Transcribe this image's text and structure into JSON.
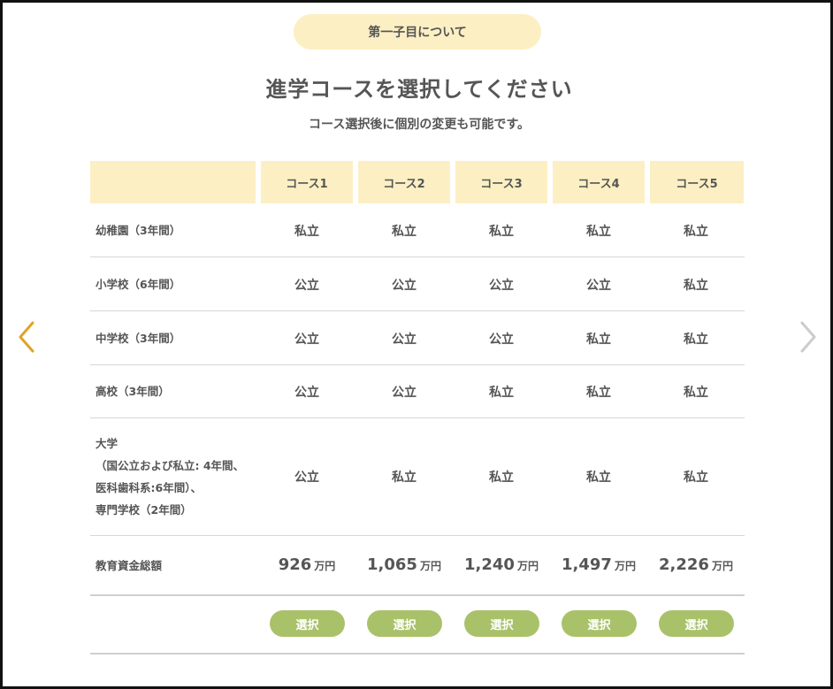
{
  "header": {
    "pill_label": "第一子目について",
    "title": "進学コースを選択してください",
    "subtitle": "コース選択後に個別の変更も可能です。"
  },
  "table": {
    "columns": [
      "コース1",
      "コース2",
      "コース3",
      "コース4",
      "コース5"
    ],
    "rows": [
      {
        "label": "幼稚園（3年間）",
        "values": [
          "私立",
          "私立",
          "私立",
          "私立",
          "私立"
        ]
      },
      {
        "label": "小学校（6年間）",
        "values": [
          "公立",
          "公立",
          "公立",
          "公立",
          "私立"
        ]
      },
      {
        "label": "中学校（3年間）",
        "values": [
          "公立",
          "公立",
          "公立",
          "私立",
          "私立"
        ]
      },
      {
        "label": "高校（3年間）",
        "values": [
          "公立",
          "公立",
          "私立",
          "私立",
          "私立"
        ]
      },
      {
        "label_lines": [
          "大学",
          "（国公立および私立: 4年間、",
          "医科歯科系:6年間）、",
          "専門学校（2年間）"
        ],
        "values": [
          "公立",
          "私立",
          "私立",
          "私立",
          "私立"
        ]
      }
    ],
    "total": {
      "label": "教育資金総額",
      "amounts": [
        "926",
        "1,065",
        "1,240",
        "1,497",
        "2,226"
      ],
      "unit": "万円"
    },
    "select_label": "選択"
  },
  "nav": {
    "left_icon": "chevron-left-icon",
    "right_icon": "chevron-right-icon"
  },
  "colors": {
    "header_bg": "#fcefc3",
    "button_bg": "#a9c26a",
    "arrow_active": "#e0a32a",
    "arrow_inactive": "#cccccc"
  }
}
